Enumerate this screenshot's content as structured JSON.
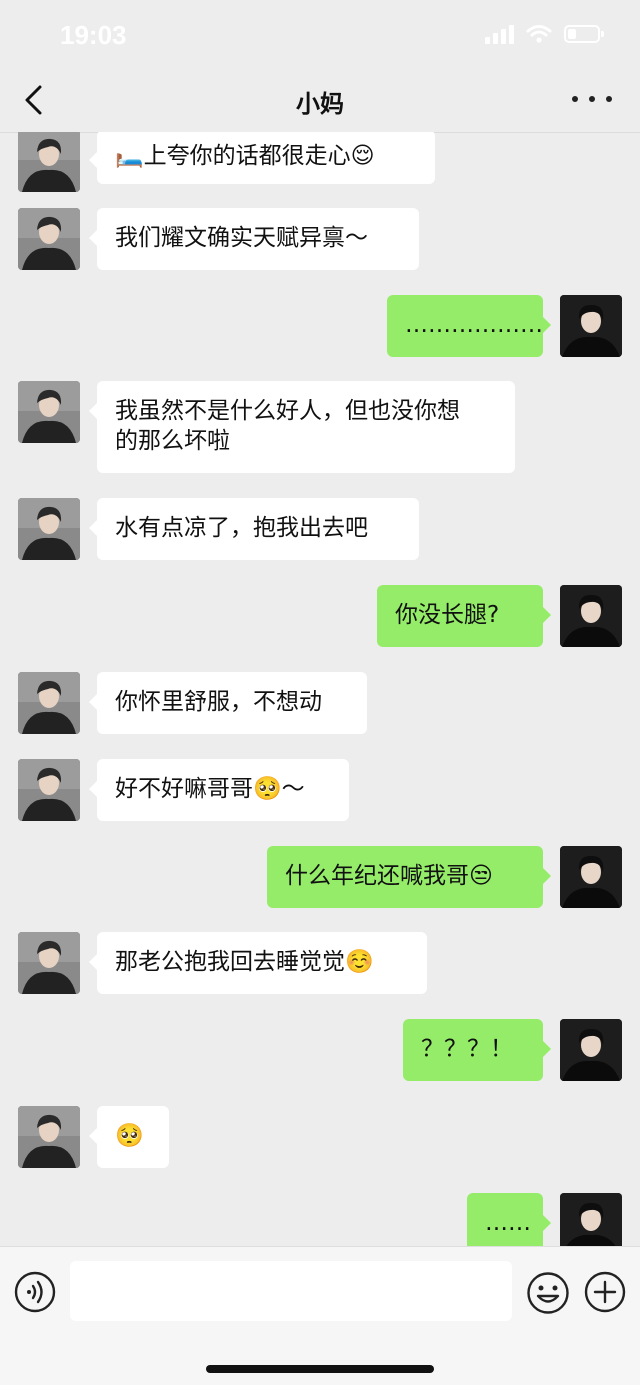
{
  "status_bar": {
    "time": "19:03"
  },
  "header": {
    "title": "小妈"
  },
  "messages": [
    {
      "side": "them",
      "text": "🛏️上夸你的话都很走心😌"
    },
    {
      "side": "them",
      "text": "我们耀文确实天赋异禀～"
    },
    {
      "side": "me",
      "text": "………………"
    },
    {
      "side": "them",
      "text": "我虽然不是什么好人，但也没你想\n的那么坏啦"
    },
    {
      "side": "them",
      "text": "水有点凉了，抱我出去吧"
    },
    {
      "side": "me",
      "text": "你没长腿?"
    },
    {
      "side": "them",
      "text": "你怀里舒服，不想动"
    },
    {
      "side": "them",
      "text": "好不好嘛哥哥🥺～"
    },
    {
      "side": "me",
      "text": "什么年纪还喊我哥😒"
    },
    {
      "side": "them",
      "text": "那老公抱我回去睡觉觉☺️"
    },
    {
      "side": "me",
      "text": "？？？！"
    },
    {
      "side": "them",
      "text": "🥺"
    },
    {
      "side": "me",
      "text": "……"
    }
  ],
  "input_bar": {
    "placeholder": ""
  },
  "colors": {
    "background": "#ededed",
    "my_bubble": "#95ec69",
    "their_bubble": "#ffffff"
  },
  "icons": {
    "back": "chevron-left-icon",
    "more": "more-dots-icon",
    "voice": "voice-icon",
    "emoji": "emoji-icon",
    "plus": "plus-icon"
  }
}
